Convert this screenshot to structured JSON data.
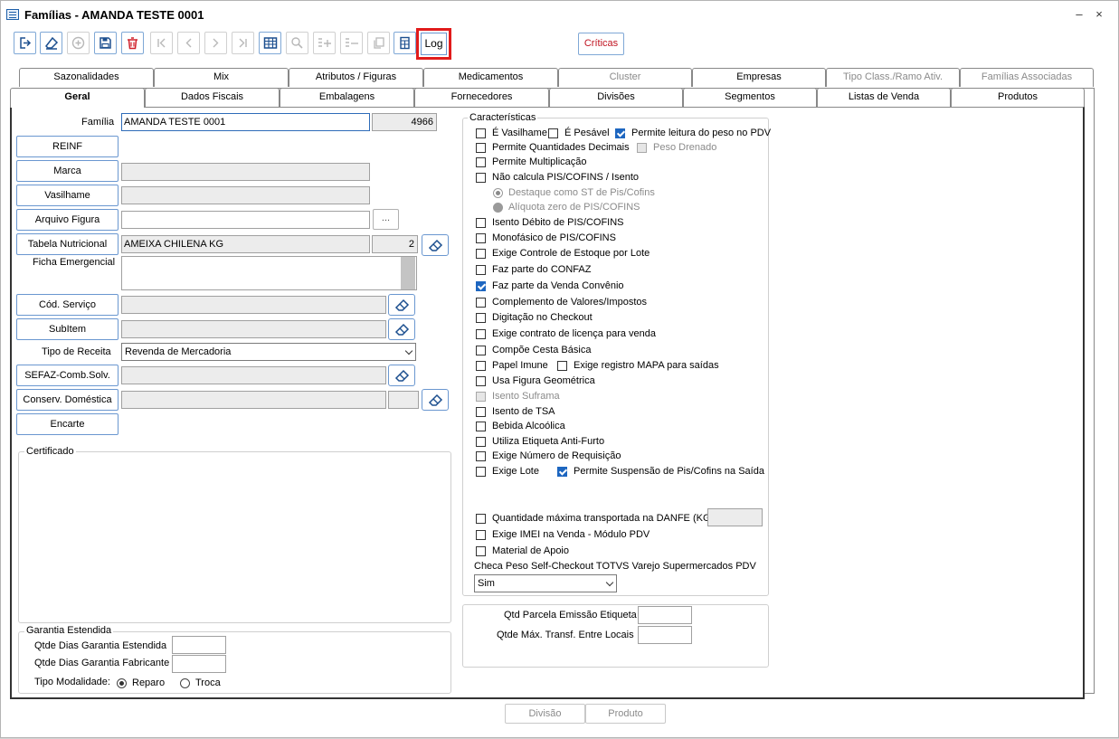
{
  "window": {
    "title": "Famílias - AMANDA TESTE 0001",
    "minimize": "–",
    "close": "×"
  },
  "toolbar": {
    "buttons": [
      {
        "name": "exit-button",
        "icon": "exit-icon",
        "enabled": true
      },
      {
        "name": "clear-button",
        "icon": "eraser-icon",
        "enabled": true
      },
      {
        "name": "add-button",
        "icon": "plus-circle-icon",
        "enabled": false
      },
      {
        "name": "save-button",
        "icon": "floppy-disk-icon",
        "enabled": true
      },
      {
        "name": "delete-button",
        "icon": "trash-icon",
        "enabled": true
      },
      {
        "name": "first-record-button",
        "icon": "skip-first-icon",
        "enabled": false
      },
      {
        "name": "previous-record-button",
        "icon": "chevron-left-icon",
        "enabled": false
      },
      {
        "name": "next-record-button",
        "icon": "chevron-right-icon",
        "enabled": false
      },
      {
        "name": "last-record-button",
        "icon": "skip-last-icon",
        "enabled": false
      },
      {
        "name": "grid-button",
        "icon": "table-icon",
        "enabled": true
      },
      {
        "name": "search-button",
        "icon": "search-icon",
        "enabled": false
      },
      {
        "name": "add-row-button",
        "icon": "list-add-icon",
        "enabled": false
      },
      {
        "name": "remove-row-button",
        "icon": "list-remove-icon",
        "enabled": false
      },
      {
        "name": "copy-button",
        "icon": "copy-icon",
        "enabled": false
      },
      {
        "name": "calculator-button",
        "icon": "calculator-icon",
        "enabled": true
      }
    ],
    "log_label": "Log",
    "criticas_label": "Críticas"
  },
  "tabs_row1": [
    {
      "label": "Sazonalidades",
      "enabled": true
    },
    {
      "label": "Mix",
      "enabled": true
    },
    {
      "label": "Atributos / Figuras",
      "enabled": true
    },
    {
      "label": "Medicamentos",
      "enabled": true
    },
    {
      "label": "Cluster",
      "enabled": false
    },
    {
      "label": "Empresas",
      "enabled": true
    },
    {
      "label": "Tipo Class./Ramo Ativ.",
      "enabled": false
    },
    {
      "label": "Famílias Associadas",
      "enabled": false
    }
  ],
  "tabs_row2": [
    {
      "label": "Geral",
      "selected": true
    },
    {
      "label": "Dados Fiscais"
    },
    {
      "label": "Embalagens"
    },
    {
      "label": "Fornecedores"
    },
    {
      "label": "Divisões"
    },
    {
      "label": "Segmentos"
    },
    {
      "label": "Listas de Venda"
    },
    {
      "label": "Produtos"
    }
  ],
  "left": {
    "familia_label": "Família",
    "familia_value": "AMANDA TESTE 0001",
    "familia_code": "4966",
    "reinf": "REINF",
    "marca": "Marca",
    "vasilhame": "Vasilhame",
    "arquivo_figura": "Arquivo Figura",
    "dots": "...",
    "tabela_nutricional": "Tabela Nutricional",
    "tabela_value": "AMEIXA CHILENA KG",
    "tabela_code": "2",
    "ficha_emergencial": "Ficha Emergencial",
    "cod_servico": "Cód. Serviço",
    "subitem": "SubItem",
    "tipo_receita_label": "Tipo de Receita",
    "tipo_receita_value": "Revenda de Mercadoria",
    "sefaz": "SEFAZ-Comb.Solv.",
    "conserv": "Conserv. Doméstica",
    "encarte": "Encarte",
    "certificado": "Certificado",
    "garantia_title": "Garantia Estendida",
    "qtde_dias_garantia": "Qtde Dias Garantia Estendida",
    "qtde_dias_fabricante": "Qtde Dias Garantia Fabricante",
    "tipo_modalidade": "Tipo Modalidade:",
    "reparo": "Reparo",
    "troca": "Troca"
  },
  "caracteristicas": {
    "title": "Características",
    "e_vasilhame": "É Vasilhame",
    "e_pesavel": "É Pesável",
    "permite_leitura": "Permite leitura do peso no PDV",
    "permite_qtd_decimais": "Permite Quantidades Decimais",
    "peso_drenado": "Peso Drenado",
    "permite_multiplicacao": "Permite Multiplicação",
    "nao_calcula": "Não calcula PIS/COFINS / Isento",
    "destaque_st": "Destaque como ST de Pis/Cofins",
    "aliquota_zero": "Alíquota zero de PIS/COFINS",
    "isento_debito": "Isento Débito de PIS/COFINS",
    "monofasico": "Monofásico de PIS/COFINS",
    "exige_controle": "Exige Controle de Estoque por Lote",
    "faz_parte_confaz": "Faz parte do CONFAZ",
    "faz_parte_venda": "Faz parte da Venda Convênio",
    "complemento": "Complemento de Valores/Impostos",
    "digitacao": "Digitação no Checkout",
    "exige_contrato": "Exige contrato de licença para venda",
    "compoe_cesta": "Compõe Cesta Básica",
    "papel_imune": "Papel Imune",
    "exige_mapa": "Exige registro MAPA para saídas",
    "usa_figura": "Usa Figura Geométrica",
    "isento_suframa": "Isento Suframa",
    "isento_tsa": "Isento de TSA",
    "bebida": "Bebida Alcoólica",
    "utiliza_etiqueta": "Utiliza Etiqueta Anti-Furto",
    "exige_requisicao": "Exige Número de Requisição",
    "exige_lote": "Exige Lote",
    "permite_suspensao": "Permite Suspensão de Pis/Cofins na Saída",
    "qtd_maxima": "Quantidade máxima transportada na DANFE (KG)",
    "exige_imei": "Exige IMEI na Venda - Módulo PDV",
    "material_apoio": "Material de Apoio",
    "checa_peso": "Checa Peso Self-Checkout TOTVS Varejo Supermercados PDV",
    "checa_peso_value": "Sim"
  },
  "qtd": {
    "parcela": "Qtd Parcela Emissão Etiqueta",
    "transf": "Qtde Máx. Transf. Entre Locais"
  },
  "bottom": {
    "divisao": "Divisão",
    "produto": "Produto"
  }
}
